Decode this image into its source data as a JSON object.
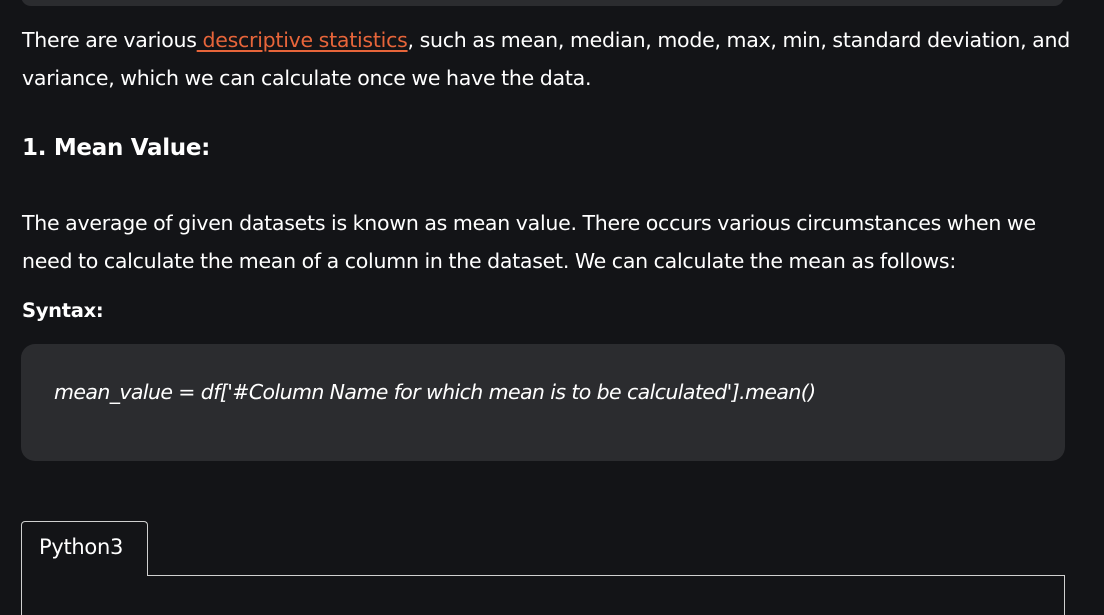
{
  "intro": {
    "prefix": "There are various",
    "link_text": " descriptive statistics",
    "suffix": ", such as mean, median, mode, max, min, standard deviation, and variance, which we can calculate once we have the data."
  },
  "section": {
    "heading": "1. Mean Value:",
    "description": "The average of given datasets is known as mean value. There occurs various circumstances when we need to calculate the mean of a column in the dataset. We can calculate the mean as follows:"
  },
  "syntax": {
    "label": "Syntax:",
    "code": "mean_value = df['#Column Name for which mean is to be calculated'].mean()"
  },
  "code_tabs": [
    {
      "label": "Python3"
    }
  ],
  "colors": {
    "background": "#131417",
    "code_block": "#2b2c2f",
    "link": "#e7653a"
  }
}
